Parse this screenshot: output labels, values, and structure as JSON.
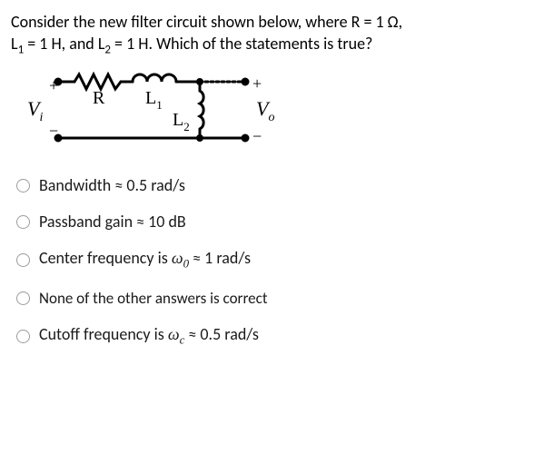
{
  "question": {
    "line1_prefix": "Consider the new filter circuit shown below, where R = 1 Ω,",
    "line2_l1": "L",
    "line2_l1_sub": "1",
    "line2_mid": " = 1 H, and L",
    "line2_l2_sub": "2",
    "line2_end": " = 1 H. Which of the statements is true?"
  },
  "circuit": {
    "vi_label": "V",
    "vi_sub": "i",
    "r_label": "R",
    "l1_label": "L",
    "l1_sub": "1",
    "l2_label": "L",
    "l2_sub": "2",
    "vo_label": "V",
    "vo_sub": "o",
    "plus": "+",
    "minus": "−"
  },
  "options": [
    {
      "text_pre": "Bandwidth ≈ 0.5 rad/s"
    },
    {
      "text_pre": "Passband gain ≈ 10 dB"
    },
    {
      "center_pre": "Center frequency is ",
      "omega": "ω",
      "omega_sub": "0",
      "center_post": " ≈ 1 rad/s"
    },
    {
      "text_pre": "None of the other answers is correct"
    },
    {
      "cutoff_pre": "Cutoff frequency is ",
      "omega": "ω",
      "omega_sub": "c",
      "cutoff_post": " ≈ 0.5 rad/s"
    }
  ]
}
